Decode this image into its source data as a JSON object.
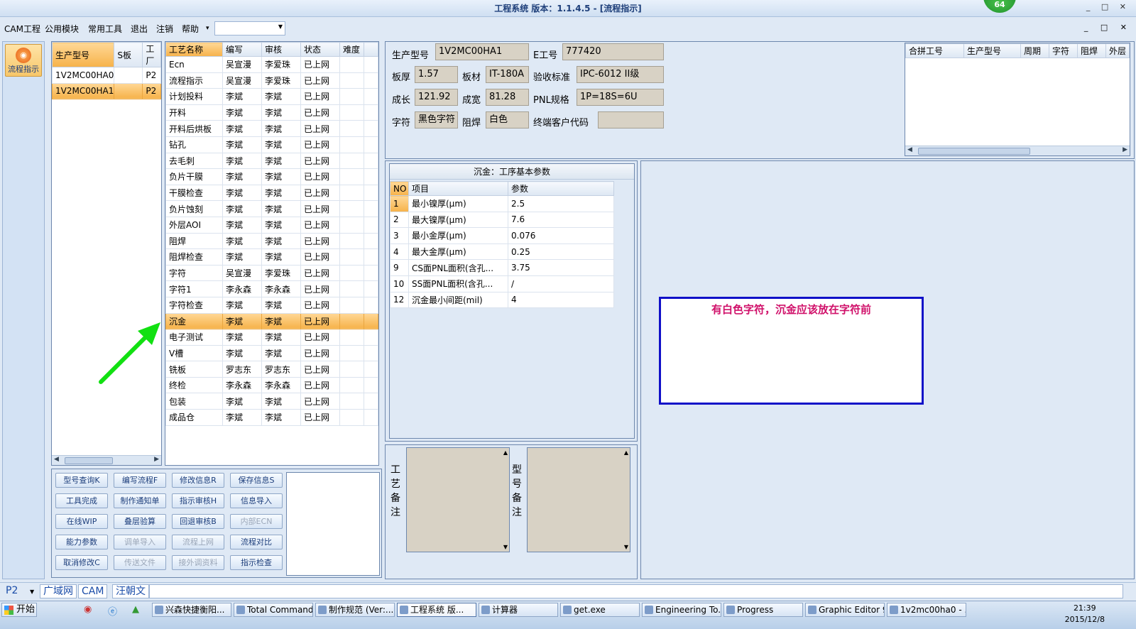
{
  "window": {
    "title": "工程系统  版本：1.1.4.5 - [流程指示]",
    "badge": "64",
    "controls": "_ □ ✕"
  },
  "menu": {
    "items": [
      "CAM工程",
      "公用模块",
      "常用工具",
      "退出",
      "注销",
      "帮助"
    ],
    "more": "▾",
    "dropdown_value": ""
  },
  "leftrail": {
    "flow_button": "流程指示"
  },
  "model_list": {
    "headers": [
      "生产型号",
      "S板",
      "工厂"
    ],
    "rows": [
      [
        "1V2MC00HA0",
        "",
        "P2"
      ],
      [
        "1V2MC00HA1",
        "",
        "P2"
      ]
    ]
  },
  "process_list": {
    "headers": [
      "工艺名称",
      "编写",
      "审核",
      "状态",
      "难度"
    ],
    "rows": [
      [
        "Ecn",
        "吴宣漫",
        "李爱珠",
        "已上网",
        ""
      ],
      [
        "流程指示",
        "吴宣漫",
        "李爱珠",
        "已上网",
        ""
      ],
      [
        "计划投料",
        "李斌",
        "李斌",
        "已上网",
        ""
      ],
      [
        "开料",
        "李斌",
        "李斌",
        "已上网",
        ""
      ],
      [
        "开料后烘板",
        "李斌",
        "李斌",
        "已上网",
        ""
      ],
      [
        "钻孔",
        "李斌",
        "李斌",
        "已上网",
        ""
      ],
      [
        "去毛刺",
        "李斌",
        "李斌",
        "已上网",
        ""
      ],
      [
        "负片干膜",
        "李斌",
        "李斌",
        "已上网",
        ""
      ],
      [
        "干膜检查",
        "李斌",
        "李斌",
        "已上网",
        ""
      ],
      [
        "负片蚀刻",
        "李斌",
        "李斌",
        "已上网",
        ""
      ],
      [
        "外层AOI",
        "李斌",
        "李斌",
        "已上网",
        ""
      ],
      [
        "阻焊",
        "李斌",
        "李斌",
        "已上网",
        ""
      ],
      [
        "阻焊检查",
        "李斌",
        "李斌",
        "已上网",
        ""
      ],
      [
        "字符",
        "吴宣漫",
        "李爱珠",
        "已上网",
        ""
      ],
      [
        "字符1",
        "李永森",
        "李永森",
        "已上网",
        ""
      ],
      [
        "字符检查",
        "李斌",
        "李斌",
        "已上网",
        ""
      ],
      [
        "沉金",
        "李斌",
        "李斌",
        "已上网",
        ""
      ],
      [
        "电子测试",
        "李斌",
        "李斌",
        "已上网",
        ""
      ],
      [
        "V槽",
        "李斌",
        "李斌",
        "已上网",
        ""
      ],
      [
        "铣板",
        "罗志东",
        "罗志东",
        "已上网",
        ""
      ],
      [
        "终检",
        "李永森",
        "李永森",
        "已上网",
        ""
      ],
      [
        "包装",
        "李斌",
        "李斌",
        "已上网",
        ""
      ],
      [
        "成品仓",
        "李斌",
        "李斌",
        "已上网",
        ""
      ]
    ]
  },
  "buttons": [
    [
      "型号查询K",
      "编写流程F",
      "修改信息R",
      "保存信息S"
    ],
    [
      "工具完成",
      "制作通知单",
      "指示审核H",
      "信息导入"
    ],
    [
      "在线WIP",
      "叠层验算",
      "回退审核B",
      "内部ECN"
    ],
    [
      "能力参数",
      "调单导入",
      "流程上网",
      "流程对比"
    ],
    [
      "取消修改C",
      "传送文件",
      "接外调资料",
      "指示检查"
    ]
  ],
  "info": {
    "model_label": "生产型号",
    "model_value": "1V2MC00HA1",
    "eno_label": "E工号",
    "eno_value": "777420",
    "thickness_label": "板厚",
    "thickness_value": "1.57",
    "material_label": "板材",
    "material_value": "IT-180A",
    "standard_label": "验收标准",
    "standard_value": "IPC-6012 II级",
    "length_label": "成长",
    "length_value": "121.92",
    "width_label": "成宽",
    "width_value": "81.28",
    "pnl_label": "PNL规格",
    "pnl_value": "1P=18S=6U",
    "char_label": "字符",
    "char_value": "黑色字符",
    "mask_label": "阻焊",
    "mask_value": "白色",
    "cust_label": "终端客户代码",
    "cust_value": ""
  },
  "combine_table": {
    "headers": [
      "合拼工号",
      "生产型号",
      "周期",
      "字符",
      "阻焊",
      "外层"
    ]
  },
  "params": {
    "title": "沉金：工序基本参数",
    "headers": [
      "NO",
      "项目",
      "参数"
    ],
    "rows": [
      [
        "1",
        "最小镍厚(μm)",
        "2.5"
      ],
      [
        "2",
        "最大镍厚(μm)",
        "7.6"
      ],
      [
        "3",
        "最小金厚(μm)",
        "0.076"
      ],
      [
        "4",
        "最大金厚(μm)",
        "0.25"
      ],
      [
        "9",
        "CS面PNL面积(含孔...",
        "3.75"
      ],
      [
        "10",
        "SS面PNL面积(含孔...",
        "/"
      ],
      [
        "12",
        "沉金最小间距(mil)",
        "4"
      ]
    ]
  },
  "remarks": {
    "process_label": "工\n艺\n备\n注",
    "model_label": "型\n号\n备\n注"
  },
  "annotation": {
    "note": "有白色字符，沉金应该放在字符前",
    "arrow_color": "#12e012",
    "box_color": "#1010c8",
    "text_color": "#d0106a"
  },
  "status": {
    "factory": "P2",
    "network": "广域网",
    "module": "CAM",
    "user": "汪朝文"
  },
  "taskbar": {
    "start": "开始",
    "row1": [
      "兴森快捷衡阳...",
      "Total Command...",
      "制作规范 (Ver:...",
      "工程系统  版...",
      "计算器",
      "get.exe",
      "Engineering To...",
      "Progress",
      "Graphic Editor 9...",
      "1v2mc00ha0 - ..."
    ],
    "clock_time": "21:39",
    "clock_date": "2015/12/8"
  }
}
